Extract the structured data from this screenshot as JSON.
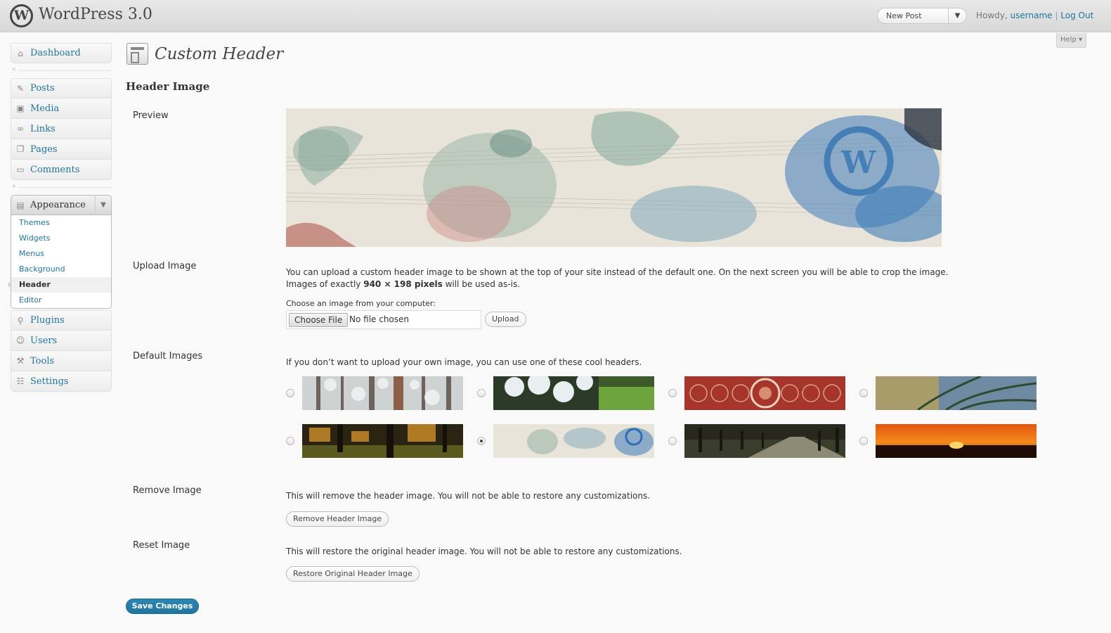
{
  "header": {
    "site_title": "WordPress 3.0",
    "logo_letter": "W",
    "new_post": "New Post",
    "howdy": "Howdy,",
    "username": "username",
    "separator": "|",
    "logout": "Log Out",
    "help": "Help ▾"
  },
  "menu": {
    "dashboard": "Dashboard",
    "posts": "Posts",
    "media": "Media",
    "links": "Links",
    "pages": "Pages",
    "comments": "Comments",
    "appearance": "Appearance",
    "appearance_sub": [
      "Themes",
      "Widgets",
      "Menus",
      "Background",
      "Header",
      "Editor"
    ],
    "plugins": "Plugins",
    "users": "Users",
    "tools": "Tools",
    "settings": "Settings",
    "collapse": "«"
  },
  "page": {
    "title": "Custom Header",
    "section": "Header Image",
    "preview_label": "Preview",
    "upload_label": "Upload Image",
    "upload_desc_1": "You can upload a custom header image to be shown at the top of your site instead of the default one. On the next screen you will be able to crop the image.",
    "upload_desc_2a": "Images of exactly ",
    "upload_desc_2b": "940 × 198 pixels",
    "upload_desc_2c": " will be used as-is.",
    "choose_label": "Choose an image from your computer:",
    "choose_file": "Choose File",
    "no_file": "No file chosen",
    "upload_btn": "Upload",
    "default_label": "Default Images",
    "default_desc": "If you don’t want to upload your own image, you can use one of these cool headers.",
    "remove_label": "Remove Image",
    "remove_desc": "This will remove the header image. You will not be able to restore any customizations.",
    "remove_btn": "Remove Header Image",
    "reset_label": "Reset Image",
    "reset_desc": "This will restore the original header image. You will not be able to restore any customizations.",
    "reset_btn": "Restore Original Header Image",
    "save_btn": "Save Changes"
  },
  "default_images": [
    {
      "name": "snowy-forest",
      "selected": false
    },
    {
      "name": "cherry-blossom",
      "selected": false
    },
    {
      "name": "red-pattern",
      "selected": false
    },
    {
      "name": "fern",
      "selected": false
    },
    {
      "name": "sunlit-forest",
      "selected": false
    },
    {
      "name": "ink-wash",
      "selected": true
    },
    {
      "name": "tree-path",
      "selected": false
    },
    {
      "name": "sunset",
      "selected": false
    }
  ],
  "colors": {
    "link": "#21759b",
    "primary_button": "#21759b"
  }
}
